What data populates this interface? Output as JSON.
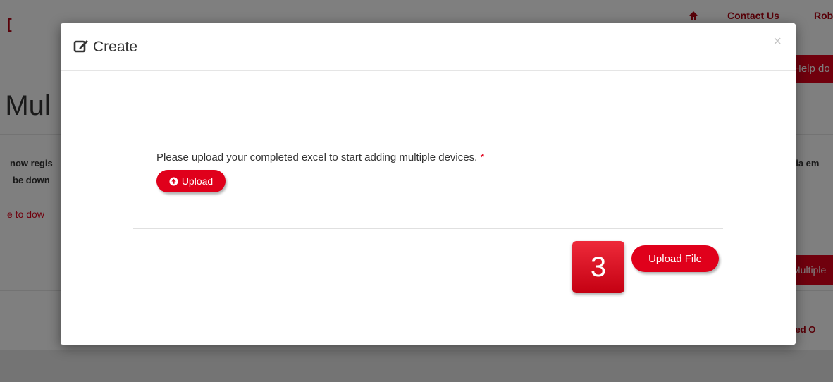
{
  "background": {
    "logo": "[",
    "contact_us": "Contact Us",
    "user_name": "Rob",
    "help_button": "Help do",
    "heading": "d Mul",
    "body_line1": "now regis",
    "body_line2": "be down",
    "download_link": "e to dow",
    "right_text": "via em",
    "multiple_button": "Multiple",
    "processed_link": "ssed O"
  },
  "modal": {
    "title": "Create",
    "close_symbol": "×",
    "instruction": "Please upload your completed excel to start adding multiple devices.",
    "required_marker": "*",
    "upload_button": "Upload",
    "step_number": "3",
    "upload_file_button": "Upload File"
  },
  "icons": {
    "edit": "edit-icon",
    "upload": "circle-arrow-up-icon",
    "home": "home-icon"
  },
  "colors": {
    "accent": "#e0001b",
    "dark_red": "#b00010",
    "overlay": "rgba(0,0,0,0.5)"
  }
}
